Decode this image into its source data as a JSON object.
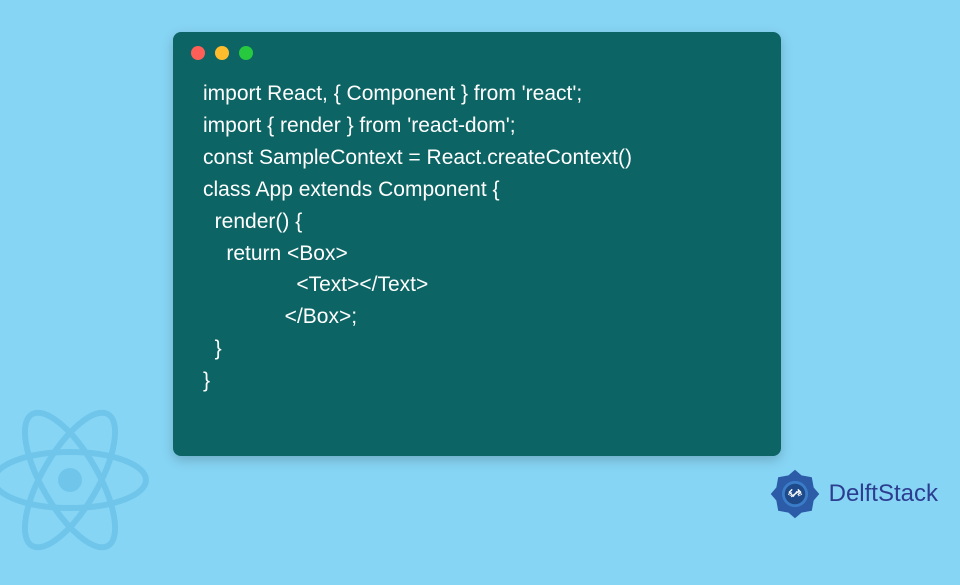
{
  "code": {
    "lines": [
      "import React, { Component } from 'react';",
      "import { render } from 'react-dom';",
      "const SampleContext = React.createContext()",
      "class App extends Component {",
      "  render() {",
      "    return <Box>",
      "                <Text></Text>",
      "              </Box>;",
      "  }",
      "}"
    ]
  },
  "branding": {
    "name": "DelftStack"
  },
  "colors": {
    "background": "#87d5f5",
    "codeBackground": "#0d6464",
    "codeText": "#ffffff",
    "brandText": "#2c3e8f",
    "reactLogo": "#5bb8e0"
  }
}
